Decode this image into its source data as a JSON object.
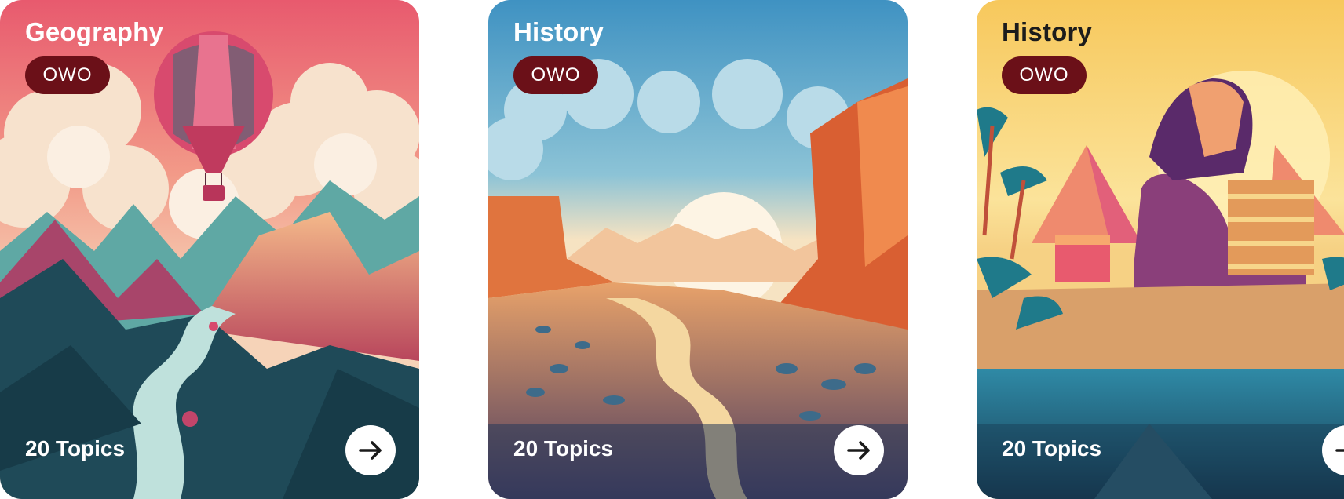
{
  "cards": [
    {
      "title": "Geography",
      "badge": "OWO",
      "topics": "20 Topics",
      "title_color": "#ffffff",
      "illustration": "hot-air-balloon-mountains"
    },
    {
      "title": "History",
      "badge": "OWO",
      "topics": "20 Topics",
      "title_color": "#ffffff",
      "illustration": "desert-canyon"
    },
    {
      "title": "History",
      "badge": "OWO",
      "topics": "20 Topics",
      "title_color": "#1c1c1c",
      "illustration": "sphinx-pyramids"
    }
  ],
  "icons": {
    "go": "arrow-right-icon"
  },
  "colors": {
    "badge_bg": "#6b1018",
    "button_bg": "#ffffff"
  }
}
